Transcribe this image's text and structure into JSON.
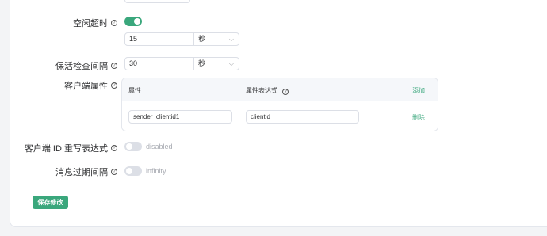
{
  "idle_timeout": {
    "label": "空闲超时",
    "enabled": true,
    "value": "15",
    "unit": "秒"
  },
  "keepalive": {
    "label": "保活检查间隔",
    "value": "30",
    "unit": "秒"
  },
  "client_attrs": {
    "label": "客户端属性",
    "col_attr": "属性",
    "col_expr": "属性表达式",
    "add_label": "添加",
    "rows": [
      {
        "attr": "sender_clientid1",
        "expr": "clientid",
        "delete_label": "删除"
      }
    ]
  },
  "clientid_override": {
    "label": "客户端 ID 重写表达式",
    "state_text": "disabled"
  },
  "msg_expiry": {
    "label": "消息过期间隔",
    "state_text": "infinity"
  },
  "save_label": "保存修改",
  "colors": {
    "accent": "#3aa77c",
    "border": "#dcdfe6"
  },
  "icons": {
    "help": "question-circle-icon",
    "chevron": "chevron-down-icon"
  }
}
